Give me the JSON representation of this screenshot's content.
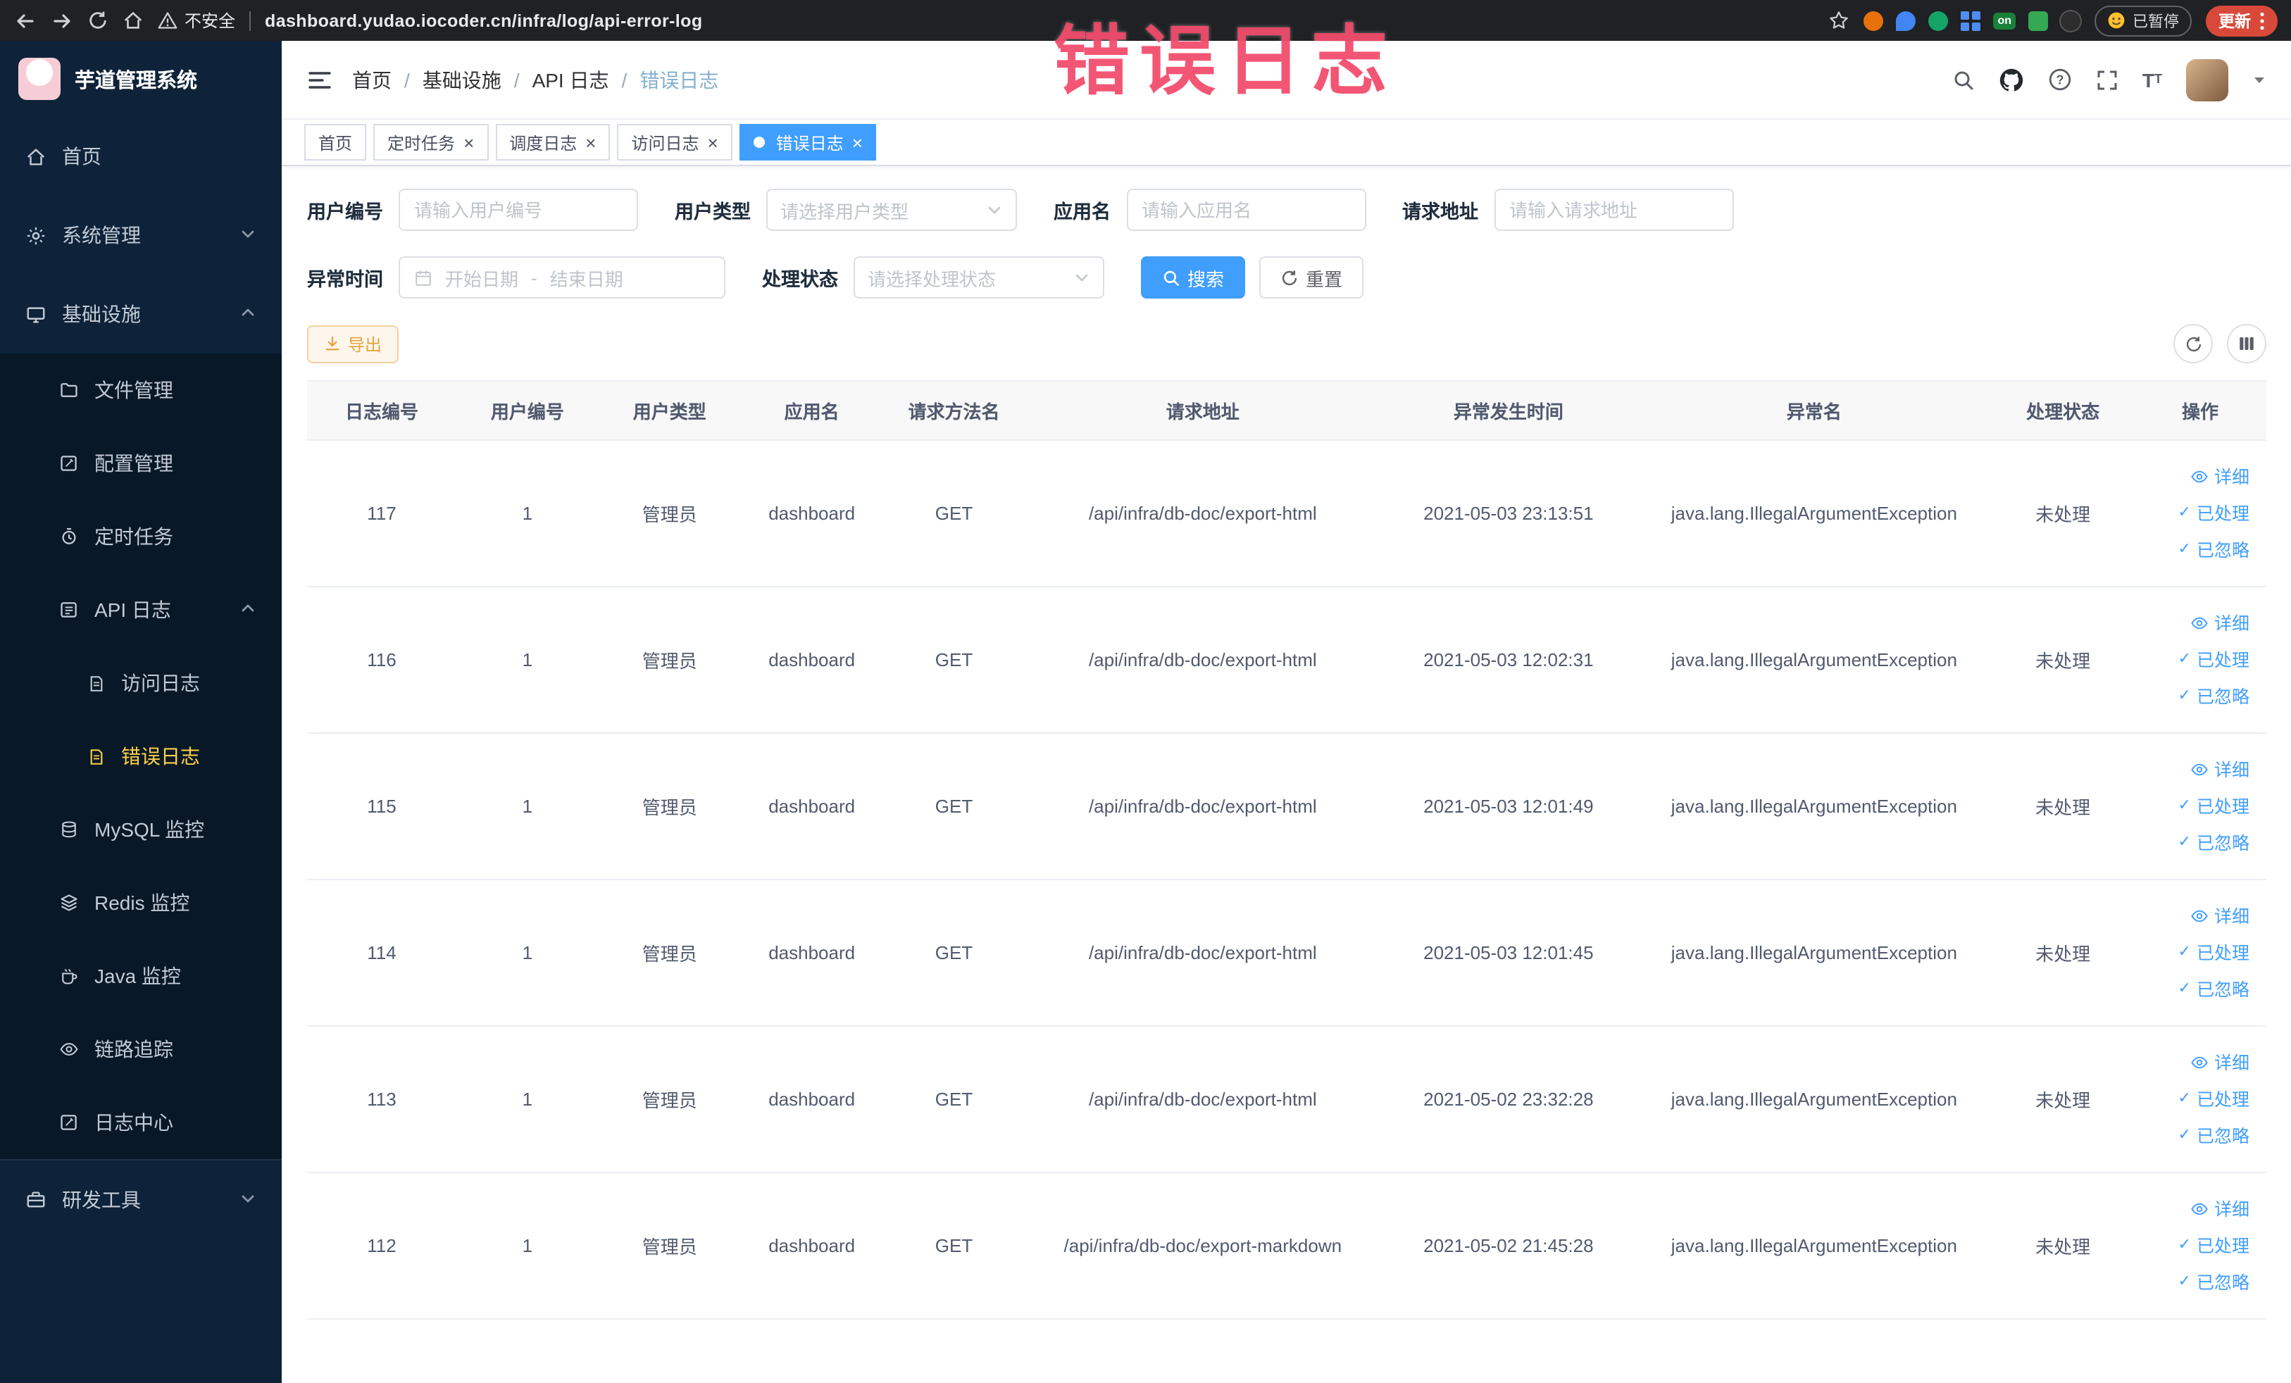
{
  "theme": {
    "primary": "#409eff",
    "sidebar_bg": "#0e2339",
    "sidebar_active_text": "#ffd04b",
    "warning": "#e6a23c",
    "annotation_red": "#f24868",
    "chrome_bg": "#202124",
    "table_header_bg": "#f8f8f9"
  },
  "annotation": {
    "text": "错误日志"
  },
  "icons": {
    "close": "×",
    "check": "✓",
    "separator": "/"
  },
  "browser": {
    "security_label": "不安全",
    "url": "dashboard.yudao.iocoder.cn/infra/log/api-error-log",
    "extension_on_label": "on",
    "paused_badge": "已暂停",
    "update_button": "更新"
  },
  "sidebar": {
    "logo_title": "芋道管理系统",
    "items": [
      {
        "label": "首页"
      },
      {
        "label": "系统管理"
      },
      {
        "label": "基础设施"
      },
      {
        "label": "文件管理"
      },
      {
        "label": "配置管理"
      },
      {
        "label": "定时任务"
      },
      {
        "label": "API 日志"
      },
      {
        "label": "访问日志"
      },
      {
        "label": "错误日志"
      },
      {
        "label": "MySQL 监控"
      },
      {
        "label": "Redis 监控"
      },
      {
        "label": "Java 监控"
      },
      {
        "label": "链路追踪"
      },
      {
        "label": "日志中心"
      },
      {
        "label": "研发工具"
      }
    ]
  },
  "header": {
    "breadcrumb": [
      "首页",
      "基础设施",
      "API 日志",
      "错误日志"
    ]
  },
  "tags_view": [
    {
      "label": "首页"
    },
    {
      "label": "定时任务"
    },
    {
      "label": "调度日志"
    },
    {
      "label": "访问日志"
    },
    {
      "label": "错误日志"
    }
  ],
  "filters": {
    "user_id_label": "用户编号",
    "user_id_placeholder": "请输入用户编号",
    "user_type_label": "用户类型",
    "user_type_placeholder": "请选择用户类型",
    "app_name_label": "应用名",
    "app_name_placeholder": "请输入应用名",
    "request_url_label": "请求地址",
    "request_url_placeholder": "请输入请求地址",
    "exception_time_label": "异常时间",
    "date_start_placeholder": "开始日期",
    "date_separator": "-",
    "date_end_placeholder": "结束日期",
    "process_status_label": "处理状态",
    "process_status_placeholder": "请选择处理状态",
    "search_button": "搜索",
    "reset_button": "重置"
  },
  "toolbar": {
    "export_button": "导出"
  },
  "table": {
    "headers": [
      "日志编号",
      "用户编号",
      "用户类型",
      "应用名",
      "请求方法名",
      "请求地址",
      "异常发生时间",
      "异常名",
      "处理状态",
      "操作"
    ],
    "action_labels": [
      "详细",
      "已处理",
      "已忽略"
    ],
    "rows": [
      {
        "id": "117",
        "user_id": "1",
        "user_type": "管理员",
        "app_name": "dashboard",
        "method": "GET",
        "url": "/api/infra/db-doc/export-html",
        "time": "2021-05-03 23:13:51",
        "exception": "java.lang.IllegalArgumentException",
        "status": "未处理"
      },
      {
        "id": "116",
        "user_id": "1",
        "user_type": "管理员",
        "app_name": "dashboard",
        "method": "GET",
        "url": "/api/infra/db-doc/export-html",
        "time": "2021-05-03 12:02:31",
        "exception": "java.lang.IllegalArgumentException",
        "status": "未处理"
      },
      {
        "id": "115",
        "user_id": "1",
        "user_type": "管理员",
        "app_name": "dashboard",
        "method": "GET",
        "url": "/api/infra/db-doc/export-html",
        "time": "2021-05-03 12:01:49",
        "exception": "java.lang.IllegalArgumentException",
        "status": "未处理"
      },
      {
        "id": "114",
        "user_id": "1",
        "user_type": "管理员",
        "app_name": "dashboard",
        "method": "GET",
        "url": "/api/infra/db-doc/export-html",
        "time": "2021-05-03 12:01:45",
        "exception": "java.lang.IllegalArgumentException",
        "status": "未处理"
      },
      {
        "id": "113",
        "user_id": "1",
        "user_type": "管理员",
        "app_name": "dashboard",
        "method": "GET",
        "url": "/api/infra/db-doc/export-html",
        "time": "2021-05-02 23:32:28",
        "exception": "java.lang.IllegalArgumentException",
        "status": "未处理"
      },
      {
        "id": "112",
        "user_id": "1",
        "user_type": "管理员",
        "app_name": "dashboard",
        "method": "GET",
        "url": "/api/infra/db-doc/export-markdown",
        "time": "2021-05-02 21:45:28",
        "exception": "java.lang.IllegalArgumentException",
        "status": "未处理"
      }
    ]
  }
}
